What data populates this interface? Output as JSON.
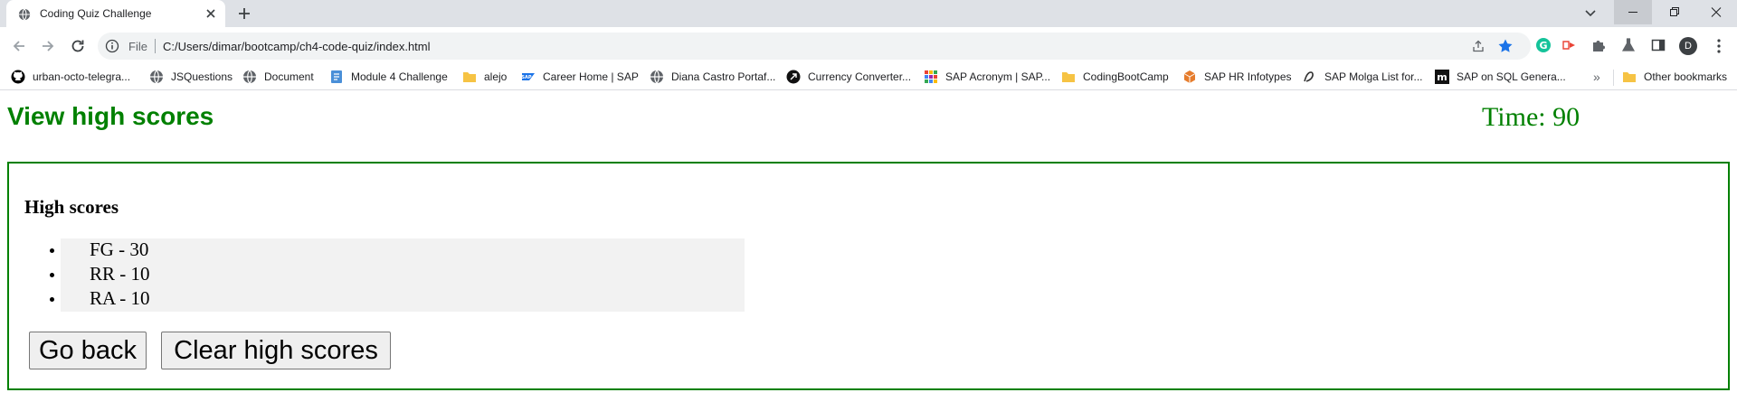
{
  "browser": {
    "tab": {
      "title": "Coding Quiz Challenge"
    },
    "omnibox": {
      "scheme_label": "File",
      "url": "C:/Users/dimar/bootcamp/ch4-code-quiz/index.html"
    },
    "avatar_initial": "D",
    "bookmarks": [
      {
        "label": "urban-octo-telegra...",
        "icon": "github-icon"
      },
      {
        "label": "JSQuestions",
        "icon": "globe-icon"
      },
      {
        "label": "Document",
        "icon": "globe-icon"
      },
      {
        "label": "Module 4 Challenge",
        "icon": "page-icon"
      },
      {
        "label": "alejo",
        "icon": "folder-icon"
      },
      {
        "label": "Career Home | SAP",
        "icon": "sap-icon"
      },
      {
        "label": "Diana Castro Portaf...",
        "icon": "globe-icon"
      },
      {
        "label": "Currency Converter...",
        "icon": "converter-icon"
      },
      {
        "label": "SAP Acronym | SAP...",
        "icon": "grid-icon"
      },
      {
        "label": "CodingBootCamp",
        "icon": "folder-icon"
      },
      {
        "label": "SAP HR Infotypes",
        "icon": "cube-icon"
      },
      {
        "label": "SAP Molga List for...",
        "icon": "molga-icon"
      },
      {
        "label": "SAP on SQL Genera...",
        "icon": "m-icon"
      }
    ],
    "overflow_label": "»",
    "other_bookmarks": {
      "label": "Other bookmarks",
      "icon": "folder-icon"
    }
  },
  "page": {
    "view_high_scores_link": "View high scores",
    "timer": "Time: 90",
    "high_scores": {
      "heading": "High scores",
      "entries": [
        "FG - 30",
        "RR - 10",
        "RA - 10"
      ]
    },
    "buttons": {
      "go_back": "Go back",
      "clear": "Clear high scores"
    }
  },
  "colors": {
    "accent_green": "#008000",
    "list_background": "#f2f2f2",
    "chrome_tabstrip": "#dee1e6",
    "omnibox_background": "#f1f3f4"
  }
}
